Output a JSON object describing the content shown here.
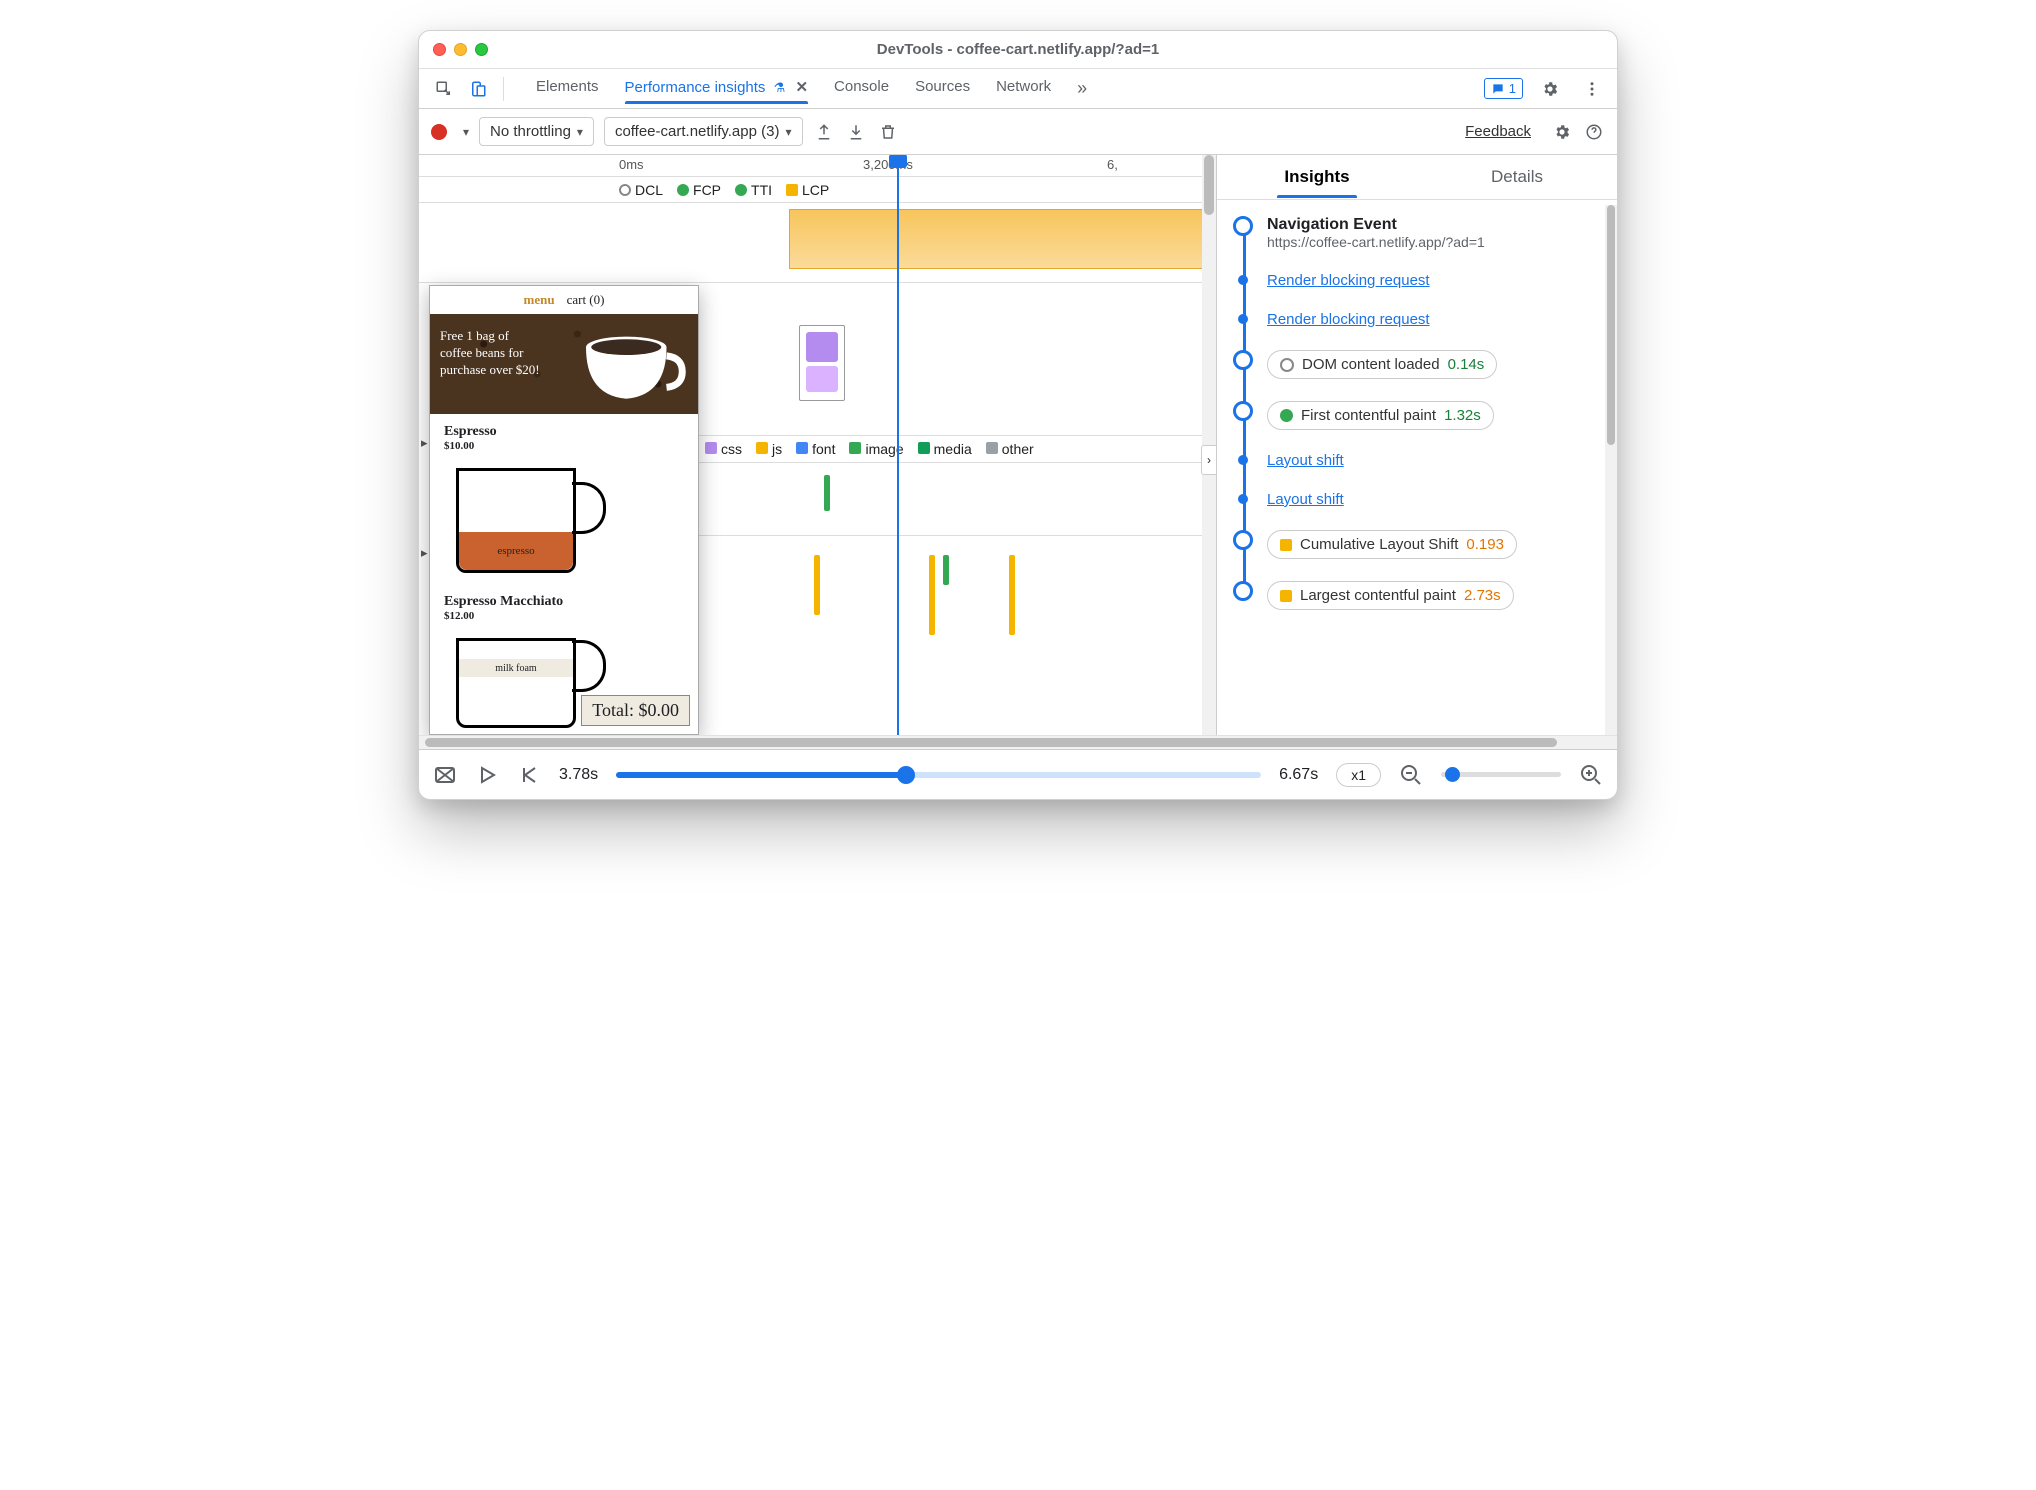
{
  "window_title": "DevTools - coffee-cart.netlify.app/?ad=1",
  "top_tabs": {
    "elements": "Elements",
    "perf": "Performance insights",
    "console": "Console",
    "sources": "Sources",
    "network": "Network"
  },
  "badge_count": "1",
  "toolbar": {
    "throttling": "No throttling",
    "session": "coffee-cart.netlify.app (3)",
    "feedback": "Feedback"
  },
  "ruler": {
    "t0": "0ms",
    "t1": "3,200ms",
    "t2": "6,"
  },
  "markers": {
    "dcl": "DCL",
    "fcp": "FCP",
    "tti": "TTI",
    "lcp": "LCP"
  },
  "net_legend": {
    "css": "css",
    "js": "js",
    "font": "font",
    "image": "image",
    "media": "media",
    "other": "other"
  },
  "shot": {
    "menu": "menu",
    "cart": "cart (0)",
    "banner": "Free 1 bag of coffee beans for purchase over $20!",
    "p1_name": "Espresso",
    "p1_price": "$10.00",
    "p1_fill": "espresso",
    "p2_name": "Espresso Macchiato",
    "p2_price": "$12.00",
    "p2_layer": "milk foam",
    "total": "Total: $0.00"
  },
  "right": {
    "tab_insights": "Insights",
    "tab_details": "Details",
    "nav_title": "Navigation Event",
    "nav_url": "https://coffee-cart.netlify.app/?ad=1",
    "rbr": "Render blocking request",
    "dcl_label": "DOM content loaded",
    "dcl_time": "0.14s",
    "fcp_label": "First contentful paint",
    "fcp_time": "1.32s",
    "ls": "Layout shift",
    "cls_label": "Cumulative Layout Shift",
    "cls_val": "0.193",
    "lcp_label": "Largest contentful paint",
    "lcp_time": "2.73s"
  },
  "bottom": {
    "cur": "3.78s",
    "end": "6.67s",
    "zoom": "x1"
  },
  "colors": {
    "blue": "#1a73e8",
    "green": "#34a853",
    "orange": "#f4b400",
    "purple": "#b48cf0",
    "font_blue": "#4285f4",
    "media_green": "#0f9d58",
    "other_gray": "#9aa0a6"
  }
}
